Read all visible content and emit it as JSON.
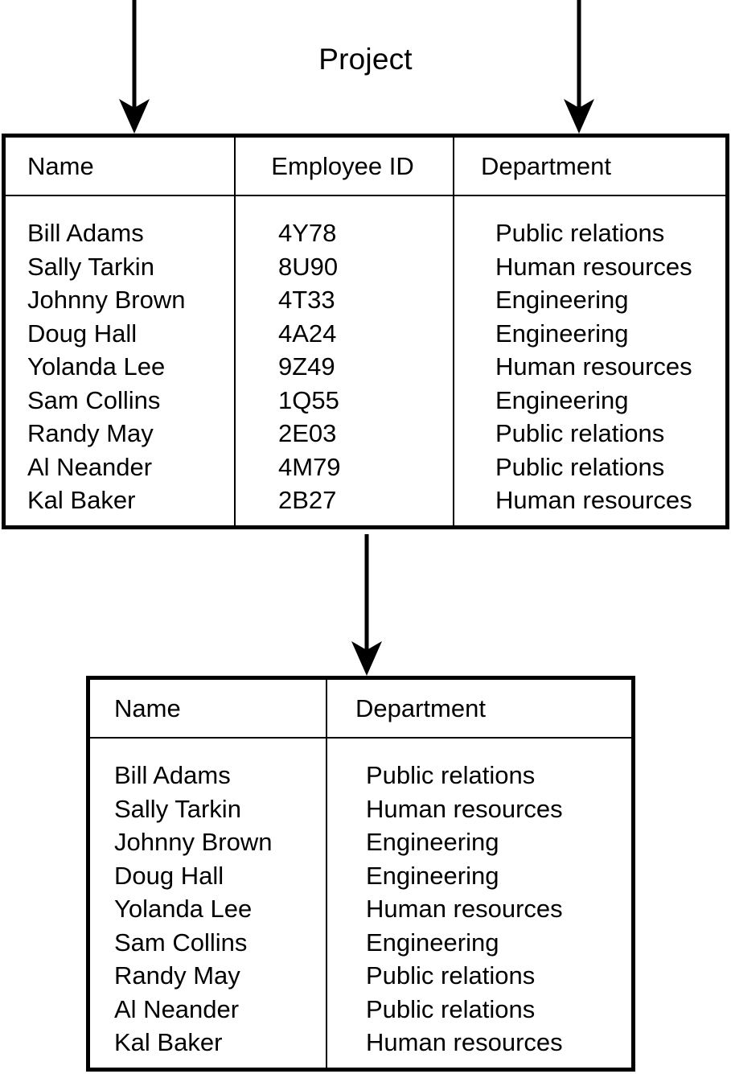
{
  "diagram": {
    "title": "Project",
    "line_color": "#000000",
    "background_color": "#ffffff"
  },
  "arrows": [
    {
      "name": "arrow-to-name-column",
      "label": ""
    },
    {
      "name": "arrow-to-department-column",
      "label": ""
    },
    {
      "name": "arrow-to-result-table",
      "label": ""
    }
  ],
  "source_table": {
    "caption": "Project",
    "columns": [
      {
        "key": "name",
        "header": "Name"
      },
      {
        "key": "employee_id",
        "header": "Employee ID"
      },
      {
        "key": "department",
        "header": "Department"
      }
    ],
    "rows": [
      {
        "name": "Bill Adams",
        "employee_id": "4Y78",
        "department": "Public relations"
      },
      {
        "name": "Sally Tarkin",
        "employee_id": "8U90",
        "department": "Human resources"
      },
      {
        "name": "Johnny Brown",
        "employee_id": "4T33",
        "department": "Engineering"
      },
      {
        "name": "Doug Hall",
        "employee_id": "4A24",
        "department": "Engineering"
      },
      {
        "name": "Yolanda Lee",
        "employee_id": "9Z49",
        "department": "Human resources"
      },
      {
        "name": "Sam Collins",
        "employee_id": "1Q55",
        "department": "Engineering"
      },
      {
        "name": "Randy May",
        "employee_id": "2E03",
        "department": "Public relations"
      },
      {
        "name": "Al Neander",
        "employee_id": "4M79",
        "department": "Public relations"
      },
      {
        "name": "Kal Baker",
        "employee_id": "2B27",
        "department": "Human resources"
      }
    ]
  },
  "result_table": {
    "columns": [
      {
        "key": "name",
        "header": "Name"
      },
      {
        "key": "department",
        "header": "Department"
      }
    ],
    "rows": [
      {
        "name": "Bill Adams",
        "department": "Public relations"
      },
      {
        "name": "Sally Tarkin",
        "department": "Human resources"
      },
      {
        "name": "Johnny Brown",
        "department": "Engineering"
      },
      {
        "name": "Doug Hall",
        "department": "Engineering"
      },
      {
        "name": "Yolanda Lee",
        "department": "Human resources"
      },
      {
        "name": "Sam Collins",
        "department": "Engineering"
      },
      {
        "name": "Randy May",
        "department": "Public relations"
      },
      {
        "name": "Al Neander",
        "department": "Public relations"
      },
      {
        "name": "Kal Baker",
        "department": "Human resources"
      }
    ]
  }
}
